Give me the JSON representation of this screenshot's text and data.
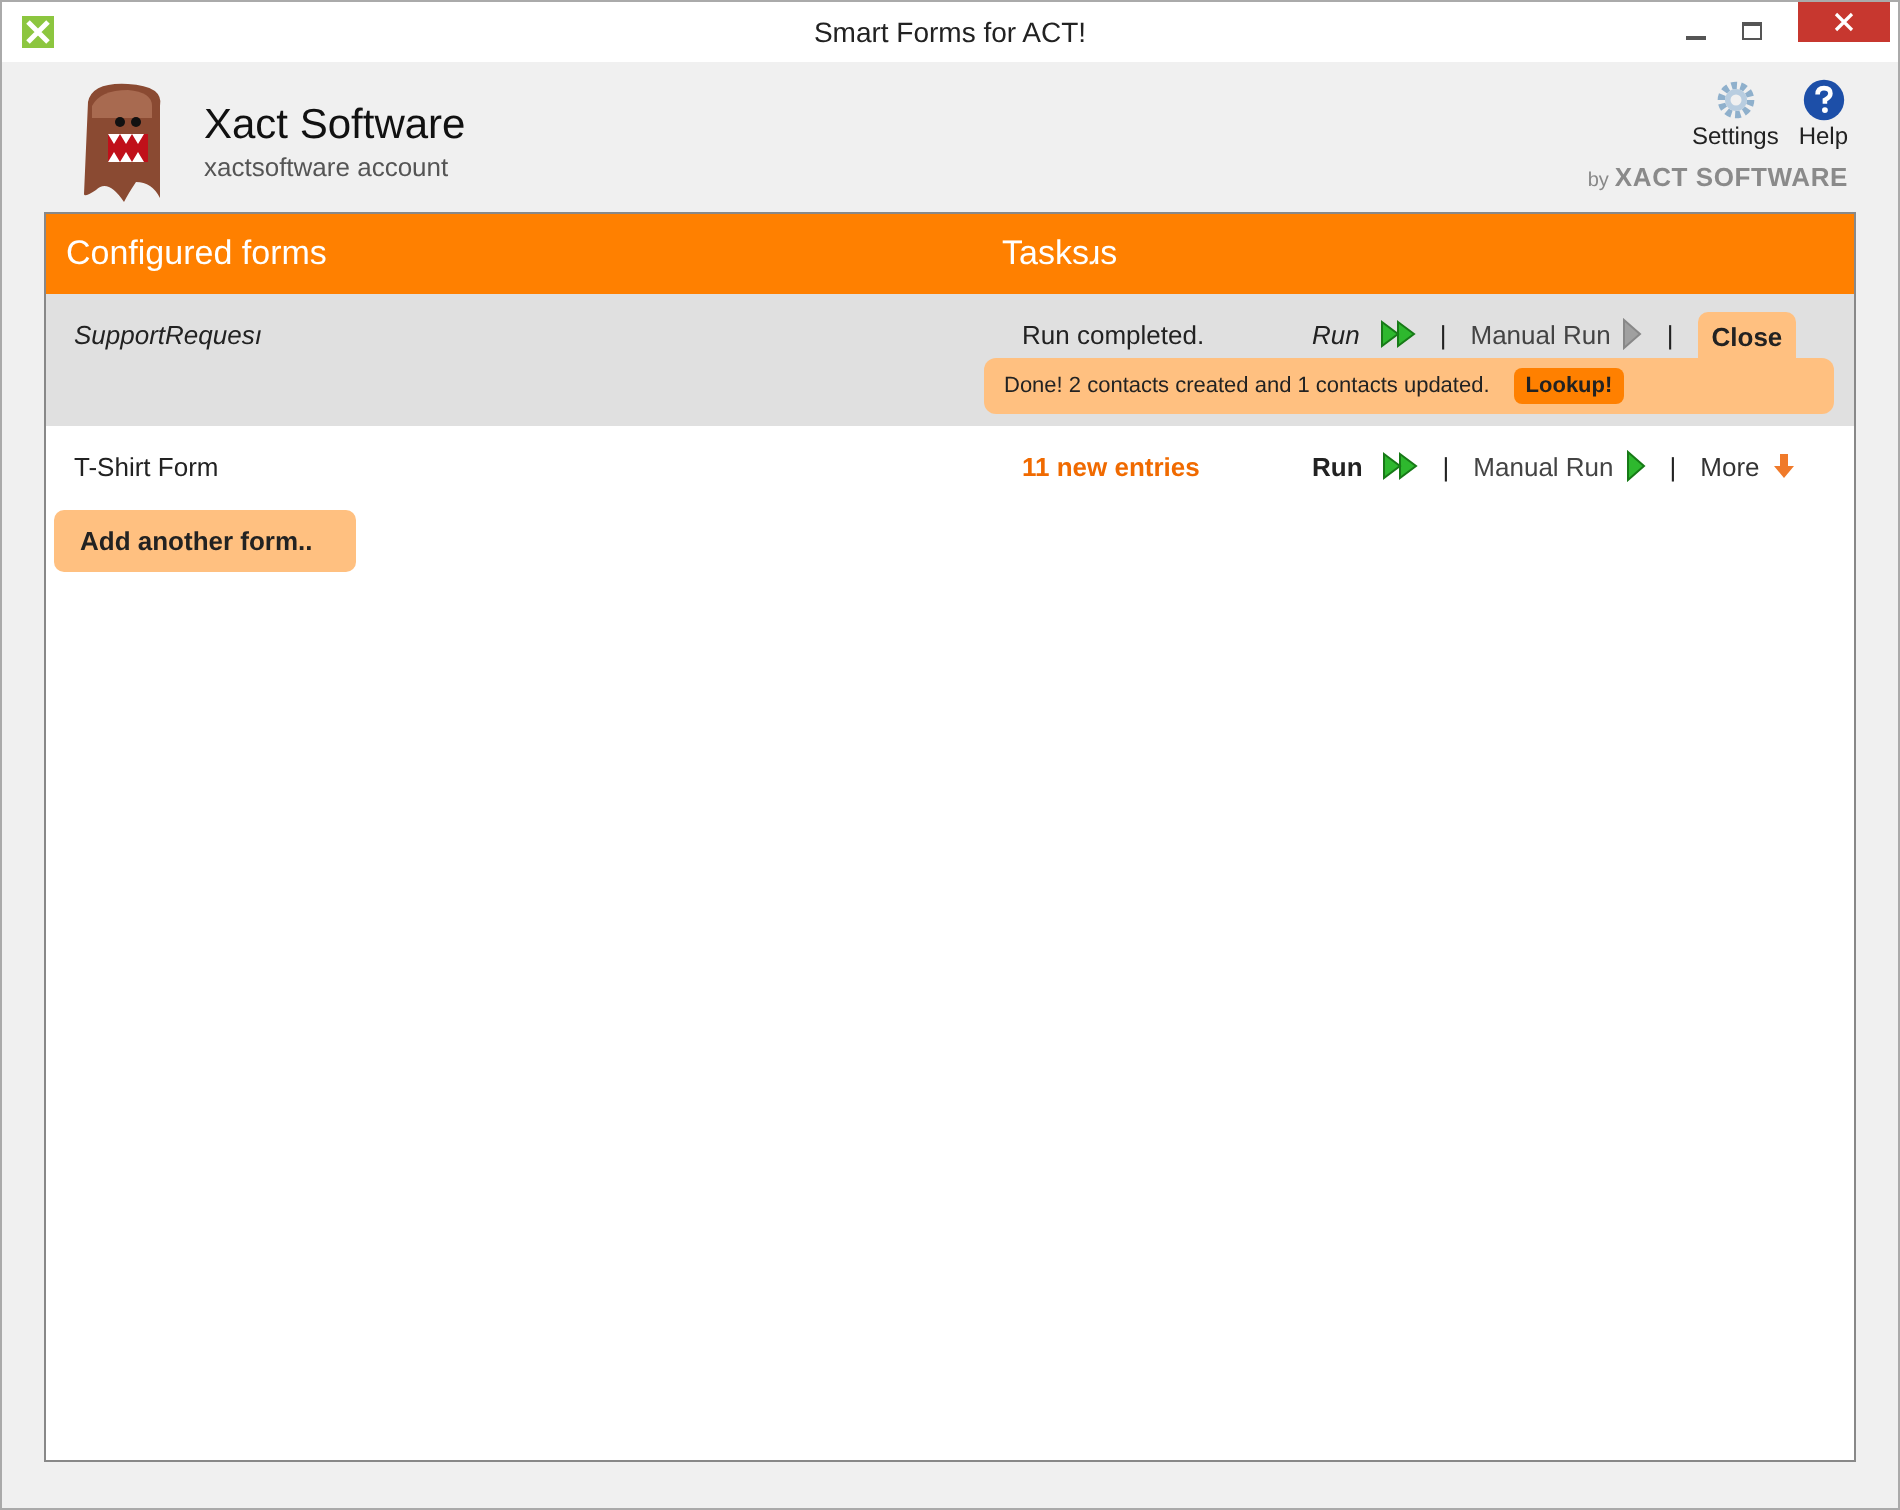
{
  "window": {
    "title": "Smart Forms for ACT!"
  },
  "account": {
    "name": "Xact Software",
    "subtitle": "xactsoftware account"
  },
  "toolbar": [
    {
      "label": "Settings",
      "kind": "settings"
    },
    {
      "label": "Help",
      "kind": "help"
    }
  ],
  "brand": {
    "by": "by",
    "name": "XACT SOFTWARE"
  },
  "table": {
    "columns": [
      "Configured forms",
      "Tasksɹs"
    ],
    "rows": [
      {
        "name": "SupportRequesı",
        "selected": true,
        "status": "Run completed.",
        "status_highlighted": false,
        "run": "Run",
        "separators": [
          "|",
          "|"
        ],
        "manual_run": "Manual Run",
        "manual_enabled": false,
        "action": {
          "label": "Close",
          "kind": "close"
        },
        "message": "Done! 2 contacts created and 1 contacts updated.",
        "message_button": "Lookup!"
      },
      {
        "name": "T-Shirt Form",
        "selected": false,
        "status": "11 new entries",
        "status_highlighted": true,
        "run": "Run",
        "separators": [
          "|",
          "|"
        ],
        "manual_run": "Manual Run",
        "manual_enabled": true,
        "action": {
          "label": "More",
          "kind": "more"
        }
      }
    ]
  },
  "add_button": "Add another form.."
}
